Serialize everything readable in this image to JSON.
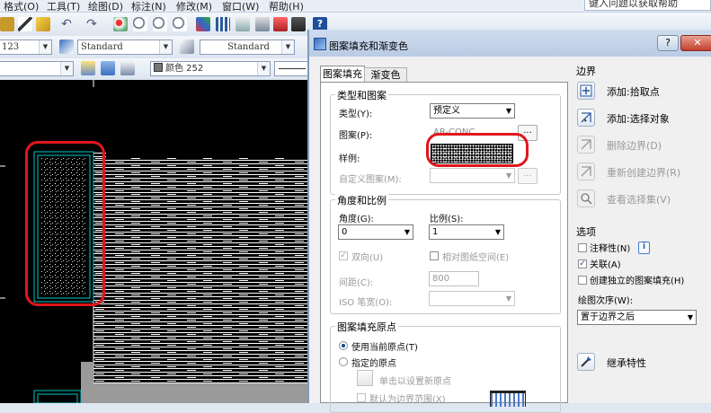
{
  "menu": {
    "items": [
      "格式(O)",
      "工具(T)",
      "绘图(D)",
      "标注(N)",
      "修改(M)",
      "窗口(W)",
      "帮助(H)"
    ],
    "help_placeholder": "键入问题以获取帮助"
  },
  "toolbar": {
    "layer_value": "123",
    "text_style": "Standard",
    "dim_style": "Standard",
    "color_label": "颜色 252"
  },
  "dialog": {
    "title": "图案填充和渐变色",
    "help_button": "?",
    "close_button": "✕",
    "tabs": [
      "图案填充",
      "渐变色"
    ],
    "type_group": {
      "title": "类型和图案",
      "type_label": "类型(Y):",
      "type_value": "预定义",
      "pattern_label": "图案(P):",
      "pattern_value": "AR-CONC",
      "pattern_browse": "...",
      "swatch_label": "样例:",
      "custom_label": "自定义图案(M):",
      "custom_browse": "..."
    },
    "angle_group": {
      "title": "角度和比例",
      "angle_label": "角度(G):",
      "angle_value": "0",
      "scale_label": "比例(S):",
      "scale_value": "1",
      "double_label": "双向(U)",
      "relative_label": "相对图纸空间(E)",
      "spacing_label": "间距(C):",
      "spacing_value": "800",
      "iso_label": "ISO 笔宽(O):"
    },
    "origin_group": {
      "title": "图案填充原点",
      "use_current": "使用当前原点(T)",
      "specified": "指定的原点",
      "click_set": "单击以设置新原点",
      "default_extent": "默认为边界范围(X)"
    },
    "boundary": {
      "title": "边界",
      "items": [
        {
          "label": "添加:拾取点",
          "icon": "pick-point-icon",
          "enabled": true
        },
        {
          "label": "添加:选择对象",
          "icon": "select-objects-icon",
          "enabled": true
        },
        {
          "label": "删除边界(D)",
          "icon": "remove-boundary-icon",
          "enabled": false
        },
        {
          "label": "重新创建边界(R)",
          "icon": "recreate-boundary-icon",
          "enabled": false
        },
        {
          "label": "查看选择集(V)",
          "icon": "view-selection-icon",
          "enabled": false
        }
      ]
    },
    "options": {
      "title": "选项",
      "annotative": "注释性(N)",
      "associative": "关联(A)",
      "independent": "创建独立的图案填充(H)",
      "draw_order_label": "绘图次序(W):",
      "draw_order_value": "置于边界之后"
    },
    "inherit": "继承特性"
  },
  "colors": {
    "highlight": "#e0161c",
    "titlebar": "#c6d5ea",
    "hatch_line": "#ffffff",
    "boundary_line": "#00c8c8"
  }
}
